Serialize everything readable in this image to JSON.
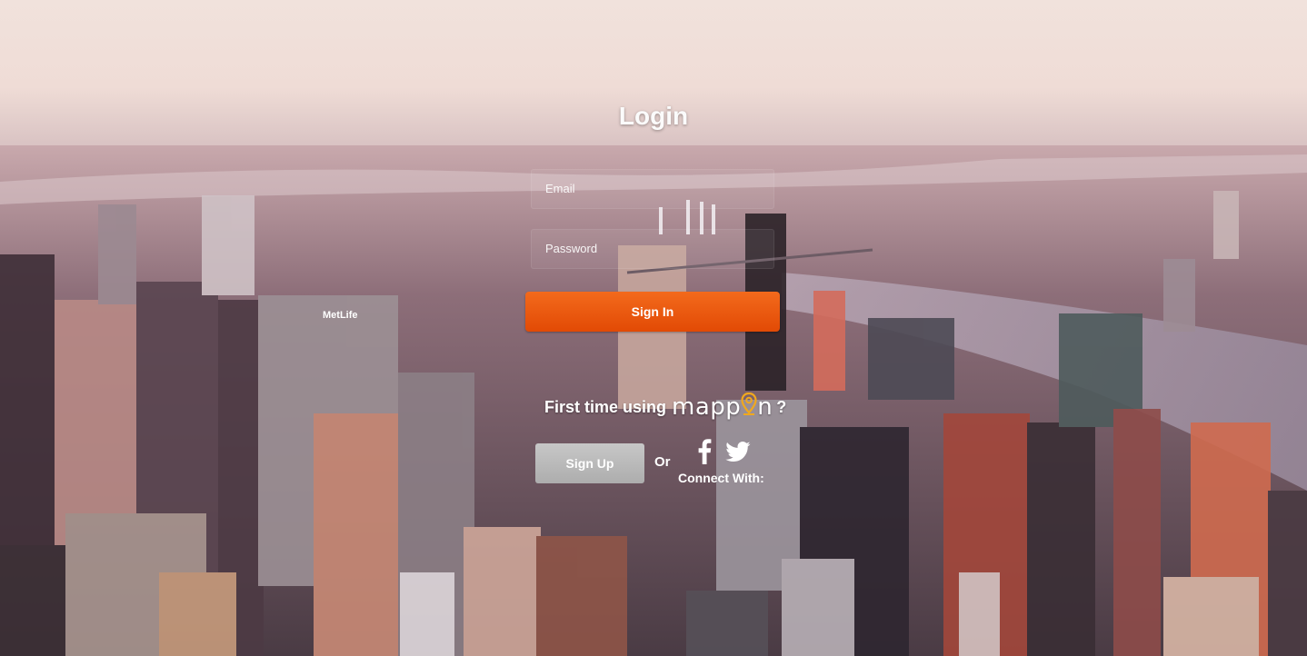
{
  "login": {
    "title": "Login",
    "email_placeholder": "Email",
    "password_placeholder": "Password",
    "signin_label": "Sign In"
  },
  "register": {
    "prompt_prefix": "First time using",
    "brand_left": "mapp",
    "brand_right": "n",
    "prompt_suffix": "?",
    "signup_label": "Sign Up",
    "or_label": "Or",
    "connect_label": "Connect With:"
  },
  "icons": {
    "facebook": "facebook-icon",
    "twitter": "twitter-icon",
    "brand_pin": "map-pin-icon"
  },
  "colors": {
    "signin": "#ee5a0f",
    "signup": "#bdbdbd",
    "brand_pin": "#f0a81e"
  }
}
